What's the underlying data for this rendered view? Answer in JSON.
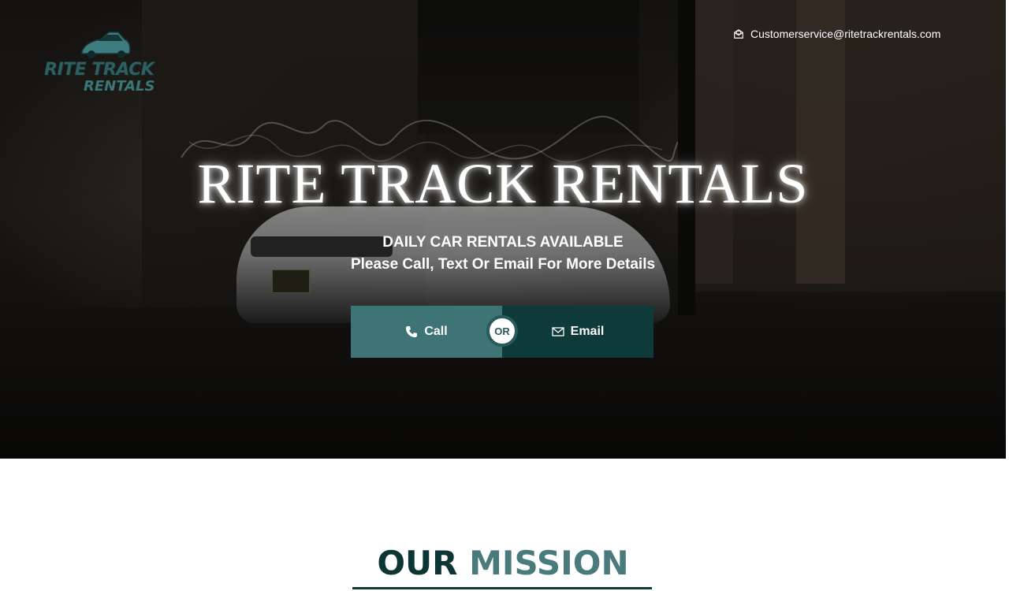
{
  "logo": {
    "line1": "RITE TRACK",
    "line2": "RENTALS"
  },
  "header": {
    "email": "Customerservice@ritetrackrentals.com"
  },
  "hero": {
    "title": "RITE TRACK RENTALS",
    "subtitle_line1": "DAILY CAR RENTALS AVAILABLE",
    "subtitle_line2": "Please Call, Text Or Email For More Details",
    "call_label": "Call",
    "or_label": "OR",
    "email_label": "Email"
  },
  "mission": {
    "word1": "OUR",
    "word2": "MISSION"
  },
  "colors": {
    "accent": "#3e7475",
    "dark_accent": "#0e3b3a",
    "mission_dark": "#0d3534",
    "mission_light": "#4a7b7c"
  }
}
